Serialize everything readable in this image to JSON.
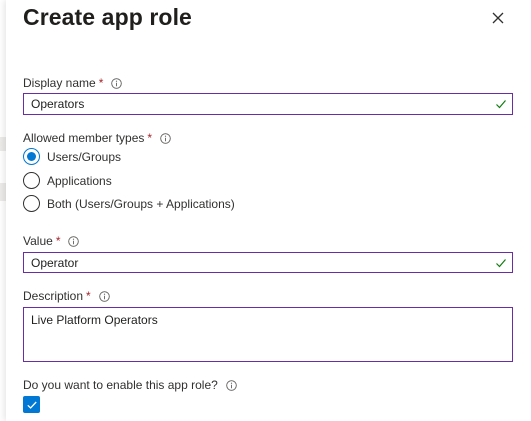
{
  "panel": {
    "title": "Create app role",
    "close_icon": "close-icon"
  },
  "display_name": {
    "label": "Display name",
    "required_mark": "*",
    "value": "Operators",
    "valid": true
  },
  "member_types": {
    "label": "Allowed member types",
    "required_mark": "*",
    "options": [
      {
        "label": "Users/Groups",
        "selected": true
      },
      {
        "label": "Applications",
        "selected": false
      },
      {
        "label": "Both (Users/Groups + Applications)",
        "selected": false
      }
    ]
  },
  "value_field": {
    "label": "Value",
    "required_mark": "*",
    "value": "Operator",
    "valid": true
  },
  "description": {
    "label": "Description",
    "required_mark": "*",
    "value": "Live Platform Operators"
  },
  "enable_role": {
    "label": "Do you want to enable this app role?",
    "checked": true
  },
  "colors": {
    "accent": "#0078d4",
    "field_border": "#6b2ca4",
    "valid_check": "#107c10",
    "required": "#a4262c"
  }
}
